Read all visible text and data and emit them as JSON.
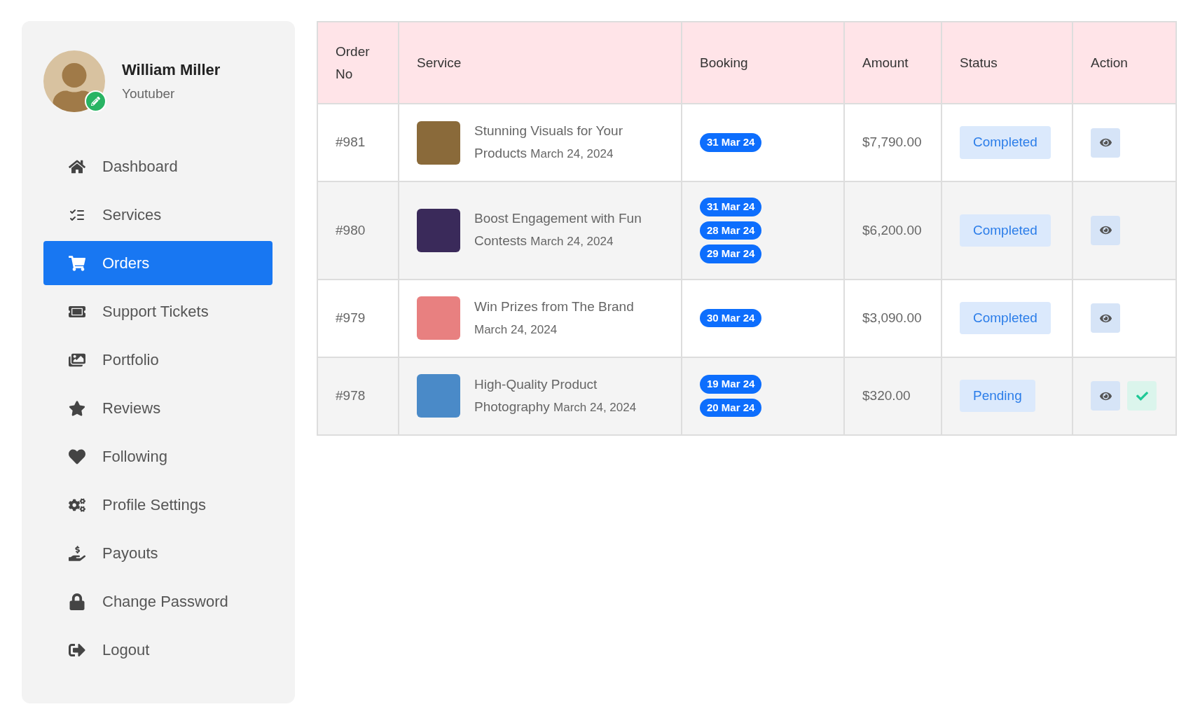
{
  "profile": {
    "name": "William Miller",
    "role": "Youtuber"
  },
  "nav": [
    {
      "label": "Dashboard",
      "selected": false
    },
    {
      "label": "Services",
      "selected": false
    },
    {
      "label": "Orders",
      "selected": true
    },
    {
      "label": "Support Tickets",
      "selected": false
    },
    {
      "label": "Portfolio",
      "selected": false
    },
    {
      "label": "Reviews",
      "selected": false
    },
    {
      "label": "Following",
      "selected": false
    },
    {
      "label": "Profile Settings",
      "selected": false
    },
    {
      "label": "Payouts",
      "selected": false
    },
    {
      "label": "Change Password",
      "selected": false
    },
    {
      "label": "Logout",
      "selected": false
    }
  ],
  "table": {
    "columns": [
      "Order No",
      "Service",
      "Booking",
      "Amount",
      "Status",
      "Action"
    ],
    "rows": [
      {
        "order": "#981",
        "title": "Stunning Visuals for Your Products",
        "date": "March 24, 2024",
        "bookings": [
          "31 Mar 24"
        ],
        "amount": "$7,790.00",
        "status": "Completed",
        "actions": [
          {
            "kind": "view"
          }
        ]
      },
      {
        "order": "#980",
        "title": "Boost Engagement with Fun Contests",
        "date": "March 24, 2024",
        "bookings": [
          "31 Mar 24",
          "28 Mar 24",
          "29 Mar 24"
        ],
        "amount": "$6,200.00",
        "status": "Completed",
        "actions": [
          {
            "kind": "view"
          }
        ]
      },
      {
        "order": "#979",
        "title": "Win Prizes from The Brand",
        "date": "March 24, 2024",
        "bookings": [
          "30 Mar 24"
        ],
        "amount": "$3,090.00",
        "status": "Completed",
        "actions": [
          {
            "kind": "view"
          }
        ]
      },
      {
        "order": "#978",
        "title": "High-Quality Product Photography",
        "date": "March 24, 2024",
        "bookings": [
          "19 Mar 24",
          "20 Mar 24"
        ],
        "amount": "$320.00",
        "status": "Pending",
        "actions": [
          {
            "kind": "view"
          },
          {
            "kind": "approve"
          }
        ]
      }
    ]
  }
}
